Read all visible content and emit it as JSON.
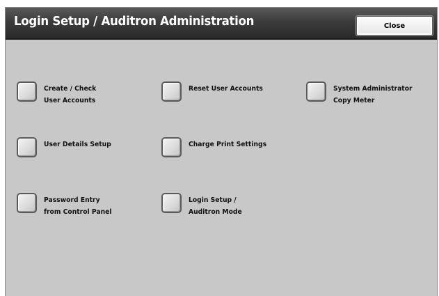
{
  "header": {
    "title": "Login Setup / Auditron Administration",
    "close_label": "Close"
  },
  "options": {
    "create_check": "Create / Check\nUser Accounts",
    "reset_accounts": "Reset User Accounts",
    "sysadmin_meter": "System Administrator\nCopy Meter",
    "user_details": "User Details Setup",
    "charge_print": "Charge Print Settings",
    "password_entry": "Password Entry\nfrom Control Panel",
    "login_mode": "Login Setup /\nAuditron Mode"
  }
}
